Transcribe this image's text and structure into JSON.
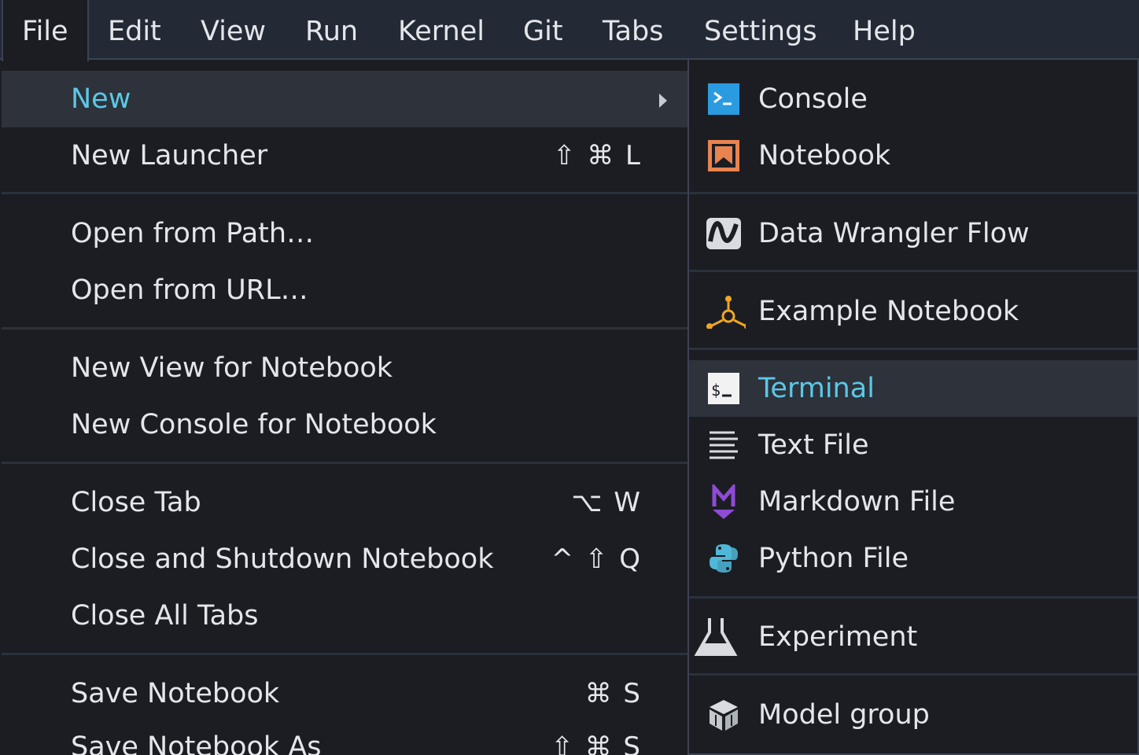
{
  "menubar": {
    "items": [
      "File",
      "Edit",
      "View",
      "Run",
      "Kernel",
      "Git",
      "Tabs",
      "Settings",
      "Help"
    ]
  },
  "file_menu": {
    "items": [
      {
        "label": "New",
        "shortcut": ""
      },
      {
        "label": "New Launcher",
        "shortcut": "⇧ ⌘ L"
      },
      {
        "label": "Open from Path…",
        "shortcut": ""
      },
      {
        "label": "Open from URL…",
        "shortcut": ""
      },
      {
        "label": "New View for Notebook",
        "shortcut": ""
      },
      {
        "label": "New Console for Notebook",
        "shortcut": ""
      },
      {
        "label": "Close Tab",
        "shortcut": "⌥ W"
      },
      {
        "label": "Close and Shutdown Notebook",
        "shortcut": "^ ⇧ Q"
      },
      {
        "label": "Close All Tabs",
        "shortcut": ""
      },
      {
        "label": "Save Notebook",
        "shortcut": "⌘ S"
      },
      {
        "label": "Save Notebook As",
        "shortcut": "⇧ ⌘ S"
      }
    ]
  },
  "new_submenu": {
    "items": [
      {
        "label": "Console",
        "icon": "console-icon"
      },
      {
        "label": "Notebook",
        "icon": "notebook-icon"
      },
      {
        "label": "Data Wrangler Flow",
        "icon": "data-wrangler-icon"
      },
      {
        "label": "Example Notebook",
        "icon": "example-notebook-icon"
      },
      {
        "label": "Terminal",
        "icon": "terminal-icon"
      },
      {
        "label": "Text File",
        "icon": "text-file-icon"
      },
      {
        "label": "Markdown File",
        "icon": "markdown-icon"
      },
      {
        "label": "Python File",
        "icon": "python-icon"
      },
      {
        "label": "Experiment",
        "icon": "flask-icon"
      },
      {
        "label": "Model group",
        "icon": "cube-icon"
      }
    ]
  },
  "colors": {
    "background": "#1b1d23",
    "menubar": "#232a36",
    "highlight_row": "#2e323b",
    "accent_text": "#5bc8e6"
  }
}
